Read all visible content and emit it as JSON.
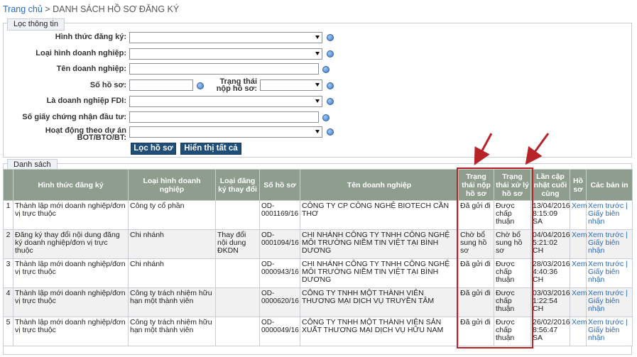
{
  "breadcrumb": {
    "home": "Trang chủ",
    "separator": " > ",
    "current": "DANH SÁCH HỒ SƠ ĐĂNG KÝ"
  },
  "filter": {
    "legend": "Lọc thông tin",
    "fields": {
      "hinh_thuc": {
        "label": "Hình thức đăng ký:",
        "value": ""
      },
      "loai_hinh": {
        "label": "Loại hình doanh nghiệp:",
        "value": ""
      },
      "ten_dn": {
        "label": "Tên doanh nghiệp:",
        "value": ""
      },
      "so_ho_so": {
        "label": "Số hồ sơ:",
        "value": ""
      },
      "trang_thai": {
        "label_line1": "Trạng thái",
        "label_line2": "nộp hồ sơ:",
        "value": ""
      },
      "fdi": {
        "label": "Là doanh nghiệp FDI:",
        "value": ""
      },
      "giay_cn": {
        "label": "Số giấy chứng nhận đầu tư:",
        "value": ""
      },
      "du_an": {
        "label_line1": "Hoạt động theo dự án",
        "label_line2": "BOT/BTO/BT:",
        "value": ""
      }
    },
    "buttons": {
      "filter": "Lọc hồ sơ",
      "show_all": "Hiển thị tất cả"
    }
  },
  "list": {
    "legend": "Danh sách",
    "headers": {
      "hinh_thuc": "Hình thức đăng ký",
      "loai_hinh": "Loại hình doanh nghiệp",
      "loai_thay_doi": "Loại đăng ký thay đổi",
      "so_ho_so": "Số hồ sơ",
      "ten_dn": "Tên doanh nghiệp",
      "trang_thai_nop": "Trạng thái nộp hồ sơ",
      "trang_thai_xl": "Trạng thái xử lý hồ sơ",
      "lan_cap_nhat": "Lần cập nhật cuối cùng",
      "ho_so": "Hồ sơ",
      "ban_in": "Các bản in"
    },
    "rows": [
      {
        "stt": "1",
        "hinh_thuc": "Thành lập mới doanh nghiệp/đơn vị trực thuộc",
        "loai_hinh": "Công ty cổ phần",
        "loai_thay_doi": "",
        "so_ho_so": "OD-0001169/16",
        "ten_dn": "CÔNG TY CP CÔNG NGHỆ BIOTECH CẦN THƠ",
        "trang_thai_nop": "Đã gửi đi",
        "trang_thai_xl": "Được chấp thuận",
        "lan_cap_nhat": "13/04/2016 8:15:09 SA",
        "ho_so": "Xem",
        "ban_in": "Xem trước | Giấy biên nhận"
      },
      {
        "stt": "2",
        "hinh_thuc": "Đăng ký thay đổi nội dung đăng ký doanh nghiệp/đơn vị trực thuộc",
        "loai_hinh": "Chi nhánh",
        "loai_thay_doi": "Thay đổi nội dung ĐKDN",
        "so_ho_so": "OD-0001094/16",
        "ten_dn": "CHI NHÁNH CÔNG TY TNHH CÔNG NGHỆ MÔI TRƯỜNG NIỀM TIN VIỆT TẠI BÌNH DƯƠNG",
        "trang_thai_nop": "Chờ bổ sung hồ sơ",
        "trang_thai_xl": "Chờ bổ sung hồ sơ",
        "lan_cap_nhat": "04/04/2016 5:21:02 CH",
        "ho_so": "Xem",
        "ban_in": "Xem trước | Giấy biên nhận"
      },
      {
        "stt": "3",
        "hinh_thuc": "Thành lập mới doanh nghiệp/đơn vị trực thuộc",
        "loai_hinh": "Chi nhánh",
        "loai_thay_doi": "",
        "so_ho_so": "OD-0000943/16",
        "ten_dn": "CHI NHÁNH CÔNG TY TNHH CÔNG NGHỆ MÔI TRƯỜNG NIỀM TIN VIỆT TẠI BÌNH DƯƠNG",
        "trang_thai_nop": "Đã gửi đi",
        "trang_thai_xl": "Được chấp thuận",
        "lan_cap_nhat": "28/03/2016 4:40:36 CH",
        "ho_so": "Xem",
        "ban_in": "Xem trước | Giấy biên nhận"
      },
      {
        "stt": "4",
        "hinh_thuc": "Thành lập mới doanh nghiệp/đơn vị trực thuộc",
        "loai_hinh": "Công ty trách nhiệm hữu hạn một thành viên",
        "loai_thay_doi": "",
        "so_ho_so": "OD-0000620/16",
        "ten_dn": "CÔNG TY TNHH MỘT THÀNH VIÊN THƯƠNG MẠI DỊCH VỤ TRUYỀN TÂM",
        "trang_thai_nop": "Đã gửi đi",
        "trang_thai_xl": "Được chấp thuận",
        "lan_cap_nhat": "03/03/2016 1:22:54 CH",
        "ho_so": "Xem",
        "ban_in": "Xem trước | Giấy biên nhận"
      },
      {
        "stt": "5",
        "hinh_thuc": "Thành lập mới doanh nghiệp/đơn vị trực thuộc",
        "loai_hinh": "Công ty trách nhiệm hữu hạn một thành viên",
        "loai_thay_doi": "",
        "so_ho_so": "OD-0000049/16",
        "ten_dn": "CÔNG TY TNHH MỘT THÀNH VIÊN SẢN XUẤT THƯƠNG MẠI DỊCH VỤ HỮU NAM",
        "trang_thai_nop": "Đã gửi đi",
        "trang_thai_xl": "Được chấp thuận",
        "lan_cap_nhat": "26/02/2016 8:56:47 SA",
        "ho_so": "Xem",
        "ban_in": "Xem trước | Giấy biên nhận"
      }
    ]
  },
  "colors": {
    "header_bg": "#8f9d8f",
    "button_bg": "#1f4e79",
    "link": "#2a6ab8",
    "highlight": "#b8232a"
  }
}
